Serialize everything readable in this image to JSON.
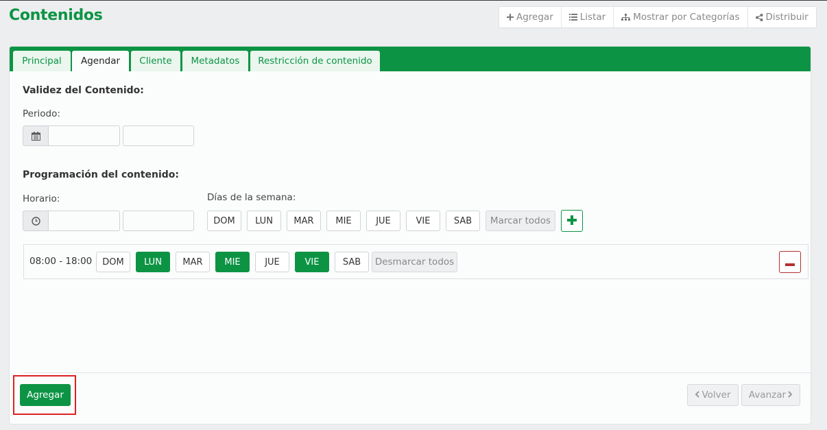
{
  "page": {
    "title": "Contenidos"
  },
  "top_actions": [
    {
      "label": "Agregar",
      "icon": "plus-icon"
    },
    {
      "label": "Listar",
      "icon": "list-icon"
    },
    {
      "label": "Mostrar por Categorías",
      "icon": "sitemap-icon"
    },
    {
      "label": "Distribuir",
      "icon": "share-icon"
    }
  ],
  "tabs": [
    {
      "label": "Principal",
      "active": false
    },
    {
      "label": "Agendar",
      "active": true
    },
    {
      "label": "Cliente",
      "active": false
    },
    {
      "label": "Metadatos",
      "active": false
    },
    {
      "label": "Restricción de contenido",
      "active": false
    }
  ],
  "validity": {
    "section_title": "Validez del Contenido:",
    "period_label": "Periodo:",
    "start_value": "",
    "end_value": ""
  },
  "programming": {
    "section_title": "Programación del contenido:",
    "schedule_label": "Horario:",
    "days_label": "Días de la semana:",
    "start_time": "",
    "end_time": "",
    "days": [
      "DOM",
      "LUN",
      "MAR",
      "MIE",
      "JUE",
      "VIE",
      "SAB"
    ],
    "mark_all_label": "Marcar todos"
  },
  "schedule_entries": [
    {
      "time_range": "08:00 - 18:00",
      "days": [
        {
          "label": "DOM",
          "selected": false
        },
        {
          "label": "LUN",
          "selected": true
        },
        {
          "label": "MAR",
          "selected": false
        },
        {
          "label": "MIE",
          "selected": true
        },
        {
          "label": "JUE",
          "selected": false
        },
        {
          "label": "VIE",
          "selected": true
        },
        {
          "label": "SAB",
          "selected": false
        }
      ],
      "unmark_all_label": "Desmarcar todos"
    }
  ],
  "footer": {
    "submit_label": "Agregar",
    "back_label": "Volver",
    "next_label": "Avanzar"
  },
  "colors": {
    "brand_green": "#0c9444",
    "danger_red": "#b23030",
    "highlight_red": "#e02020"
  }
}
